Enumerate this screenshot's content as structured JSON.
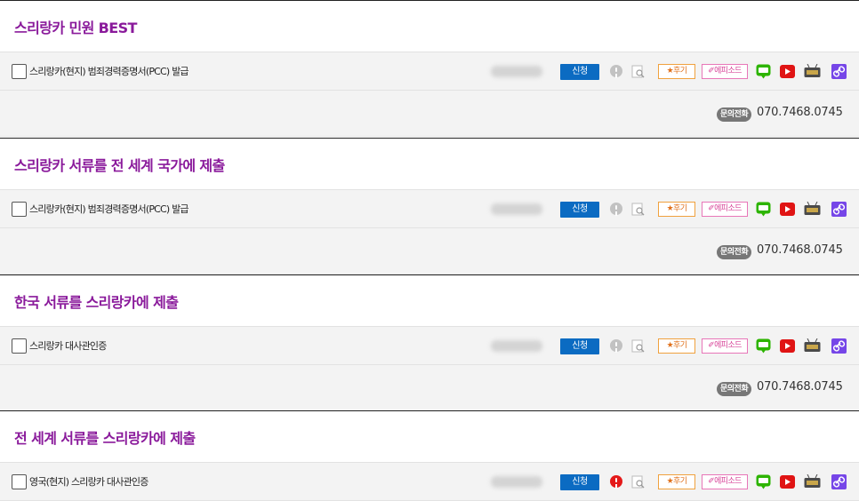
{
  "sections": [
    {
      "title": "스리랑카 민원 BEST",
      "rows": [
        {
          "label": "스리랑카(현지) 범죄경력증명서(PCC) 발급",
          "price": "blurred",
          "alert": "grey"
        }
      ],
      "phone": {
        "badge": "문의전화",
        "number": "070.7468.0745"
      }
    },
    {
      "title": "스리랑카 서류를 전 세계 국가에 제출",
      "rows": [
        {
          "label": "스리랑카(현지) 범죄경력증명서(PCC) 발급",
          "price": "blurred",
          "alert": "grey"
        }
      ],
      "phone": {
        "badge": "문의전화",
        "number": "070.7468.0745"
      }
    },
    {
      "title": "한국 서류를 스리랑카에 제출",
      "rows": [
        {
          "label": "스리랑카 대사관인증",
          "price": "blurred",
          "alert": "grey"
        }
      ],
      "phone": {
        "badge": "문의전화",
        "number": "070.7468.0745"
      }
    },
    {
      "title": "전 세계 서류를 스리랑카에 제출",
      "rows": [
        {
          "label": "영국(현지) 스리랑카 대사관인증",
          "price": "blurred",
          "alert": "red"
        }
      ]
    }
  ],
  "row_actions": {
    "apply_label": "신청",
    "review_label": "★후기",
    "episode_label": "✐에피소드",
    "icons": [
      "info-icon",
      "magnifier-icon",
      "review-tag",
      "episode-tag",
      "blog-icon",
      "youtube-icon",
      "tv-icon",
      "link-icon"
    ]
  },
  "colors": {
    "title": "#8a1a9b",
    "apply_button": "#0b6bc2",
    "alert_grey": "#c2c2c2",
    "alert_red": "#e41919"
  }
}
